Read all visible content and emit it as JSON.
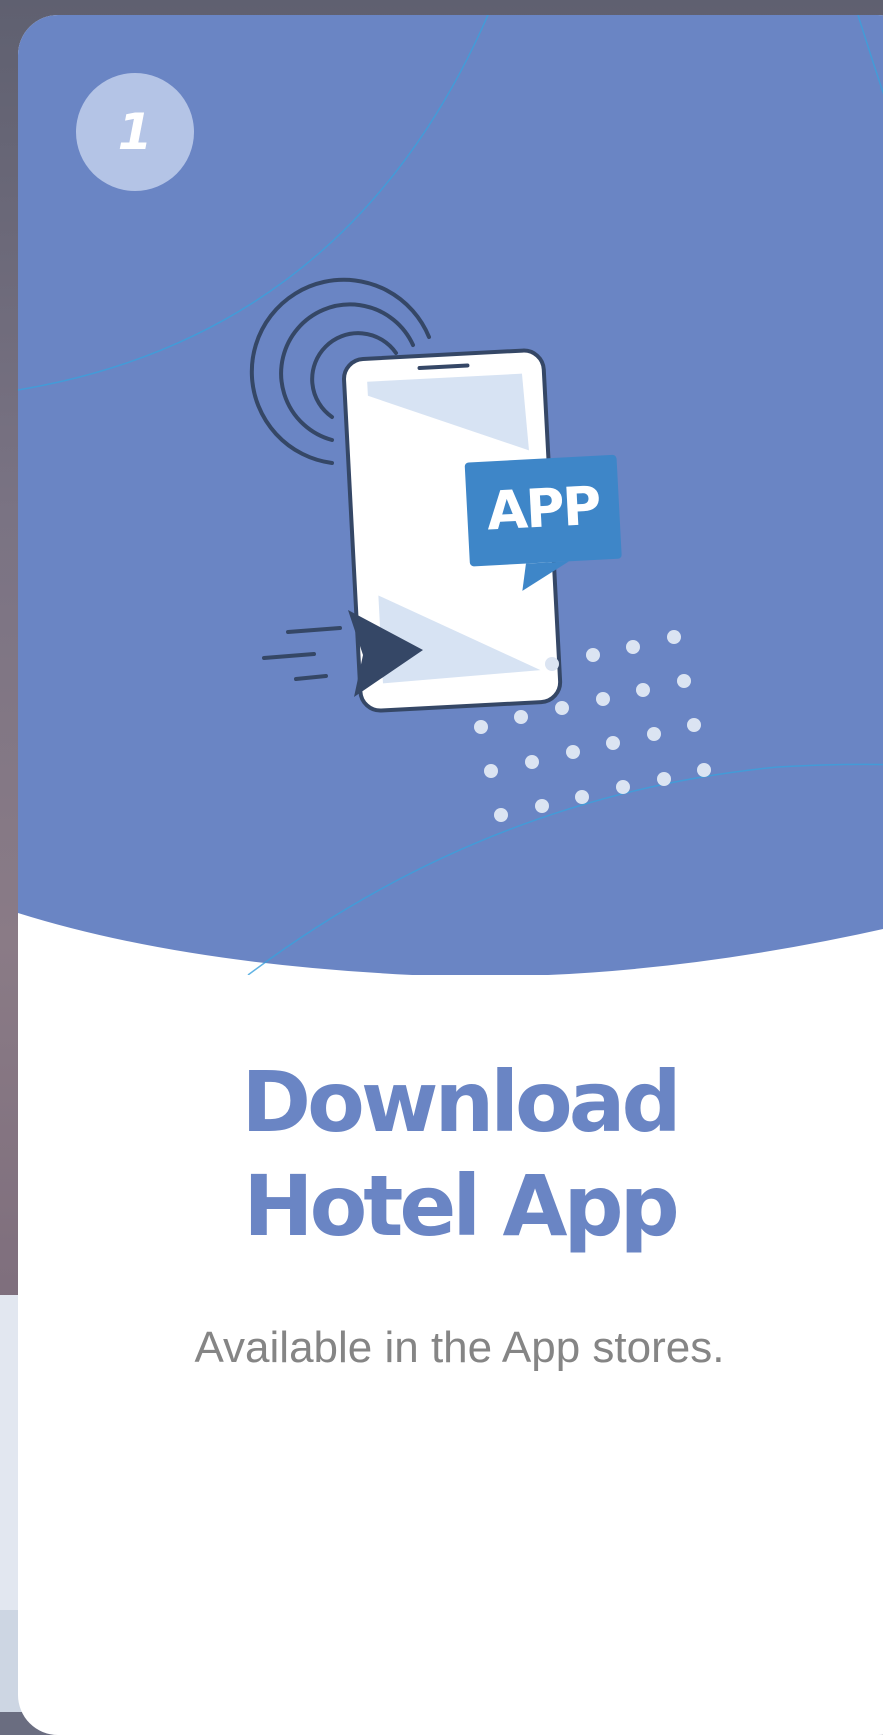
{
  "step": {
    "number": "1"
  },
  "illustration": {
    "badge_text": "APP"
  },
  "card": {
    "title_line1": "Download",
    "title_line2": "Hotel App",
    "subtitle": "Available in the App stores."
  },
  "colors": {
    "hero_background": "#6a85c4",
    "title": "#6a85c4",
    "step_badge": "#b4c4e6",
    "app_badge": "#3e86c8",
    "dark_outline": "#354766",
    "phone_screen": "#d7e3f3",
    "subtitle": "#858585"
  },
  "icons": [
    "signal-waves-icon",
    "phone-icon",
    "app-bubble-icon",
    "cursor-arrow-icon",
    "speed-lines-icon",
    "dot-pattern-icon"
  ]
}
